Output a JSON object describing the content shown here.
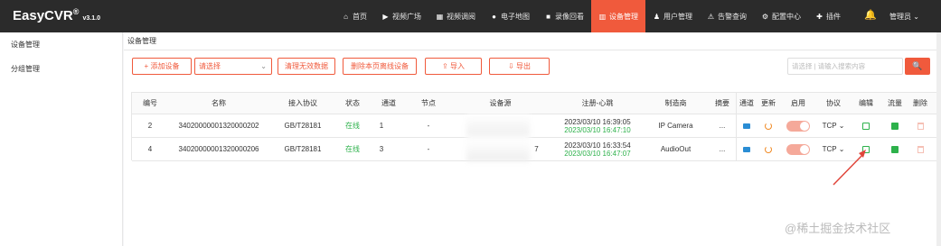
{
  "app": {
    "brand": "EasyCVR",
    "reg": "®",
    "version": "v3.1.0"
  },
  "nav": [
    {
      "label": "首页",
      "icon": "home-icon"
    },
    {
      "label": "视频广场",
      "icon": "play-icon"
    },
    {
      "label": "视频调阅",
      "icon": "grid-icon"
    },
    {
      "label": "电子地图",
      "icon": "pin-icon"
    },
    {
      "label": "录像回看",
      "icon": "camera-icon"
    },
    {
      "label": "设备管理",
      "icon": "device-icon"
    },
    {
      "label": "用户管理",
      "icon": "user-icon"
    },
    {
      "label": "告警查询",
      "icon": "alarm-icon"
    },
    {
      "label": "配置中心",
      "icon": "gear-icon"
    },
    {
      "label": "插件",
      "icon": "plugin-icon"
    }
  ],
  "header": {
    "admin": "管理员 ⌄"
  },
  "sidebar": {
    "items": [
      "设备管理",
      "分组管理"
    ]
  },
  "breadcrumb": "设备管理",
  "toolbar": {
    "add": "+ 添加设备",
    "select_placeholder": "请选择",
    "clear": "清理无效数据",
    "delete_offline": "删除本页离线设备",
    "import": "⇪ 导入",
    "export": "⇩ 导出",
    "search_placeholder": "请选择 | 请输入搜索内容",
    "search_icon": "🔍"
  },
  "table": {
    "headers": [
      "编号",
      "名称",
      "接入协议",
      "状态",
      "通道",
      "节点",
      "设备源",
      "注册-心跳",
      "制造商",
      "摘要",
      "通道",
      "更新",
      "启用",
      "协议",
      "编辑",
      "流量",
      "删除"
    ],
    "rows": [
      {
        "id": "2",
        "name": "34020000001320000202",
        "protocol": "GB/T28181",
        "status": "在线",
        "channel": "1",
        "node": "-",
        "source": "",
        "register": "2023/03/10 16:39:05",
        "heartbeat": "2023/03/10 16:47:10",
        "maker": "IP Camera",
        "summary": "...",
        "proto_sel": "TCP ⌄"
      },
      {
        "id": "4",
        "name": "34020000001320000206",
        "protocol": "GB/T28181",
        "status": "在线",
        "channel": "3",
        "node": "-",
        "source": "7",
        "register": "2023/03/10 16:33:54",
        "heartbeat": "2023/03/10 16:47:07",
        "maker": "AudioOut",
        "summary": "...",
        "proto_sel": "TCP ⌄"
      }
    ]
  },
  "watermark": "@稀土掘金技术社区",
  "colors": {
    "accent": "#f05a3c",
    "green": "#2db14b",
    "arrow": "#e0453a"
  }
}
